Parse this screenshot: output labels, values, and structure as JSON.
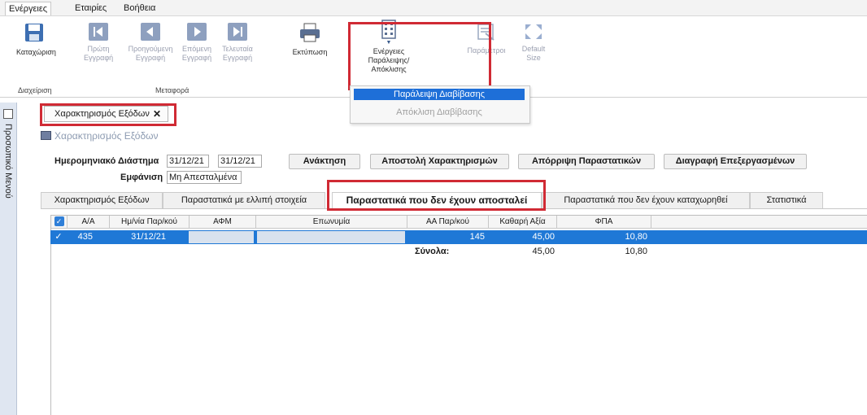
{
  "menu": {
    "actions": "Ενέργειες",
    "companies": "Εταιρίες",
    "help": "Βοήθεια"
  },
  "ribbon": {
    "save": "Καταχώριση",
    "first_record": [
      "Πρώτη",
      "Εγγραφή"
    ],
    "previous_record": [
      "Προηγούμενη",
      "Εγγραφή"
    ],
    "next_record": [
      "Επόμενη",
      "Εγγραφή"
    ],
    "last_record": [
      "Τελευταία",
      "Εγγραφή"
    ],
    "print": "Εκτύπωση",
    "skip_action": [
      "Ενέργειες",
      "Παράλειψης/Απόκλισης"
    ],
    "parameters": "Παράμετροι",
    "default_size": [
      "Default",
      "Size"
    ],
    "group_manage": "Διαχείριση",
    "group_navigation": "Μεταφορά"
  },
  "dropdown": {
    "skip_posting": "Παράλειψη Διαβίβασης",
    "exclude_posting": "Απόκλιση Διαβίβασης"
  },
  "side_panel": {
    "title": "Προσωπικό Μενού"
  },
  "doc_tab": {
    "label": "Χαρακτηρισμός Εξόδων",
    "close": "✕"
  },
  "form": {
    "title": "Χαρακτηρισμός Εξόδων",
    "date_range_label": "Ημερομηνιακό Διάστημα",
    "date_from": "31/12/21",
    "date_to": "31/12/21",
    "display_label": "Εμφάνιση",
    "display_value": "Μη Απεσταλμένα",
    "btn_retrieve": "Ανάκτηση",
    "btn_send": "Αποστολή Χαρακτηρισμών",
    "btn_reject": "Απόρριψη Παραστατικών",
    "btn_delete": "Διαγραφή Επεξεργασμένων"
  },
  "subtabs": [
    "Χαρακτηρισμός Εξόδων",
    "Παραστατικά με ελλιπή στοιχεία",
    "Παραστατικά που δεν έχουν αποσταλεί",
    "Παραστατικά που δεν έχουν καταχωρηθεί",
    "Στατιστικά"
  ],
  "grid": {
    "headers": [
      "Α/Α",
      "Ημ/νία Παρ/κού",
      "ΑΦΜ",
      "Επωνυμία",
      "ΑΑ Παρ/κού",
      "Καθαρή Αξία",
      "ΦΠΑ"
    ],
    "row": {
      "aa": "435",
      "date": "31/12/21",
      "afm": "",
      "name": "",
      "doc_no": "145",
      "net": "45,00",
      "vat": "10,80"
    },
    "totals_label": "Σύνολα:",
    "totals_net": "45,00",
    "totals_vat": "10,80"
  },
  "colors": {
    "highlight_red": "#d02a34",
    "selection_blue": "#1f78d6",
    "menu_selected": "#1e6fd8"
  }
}
